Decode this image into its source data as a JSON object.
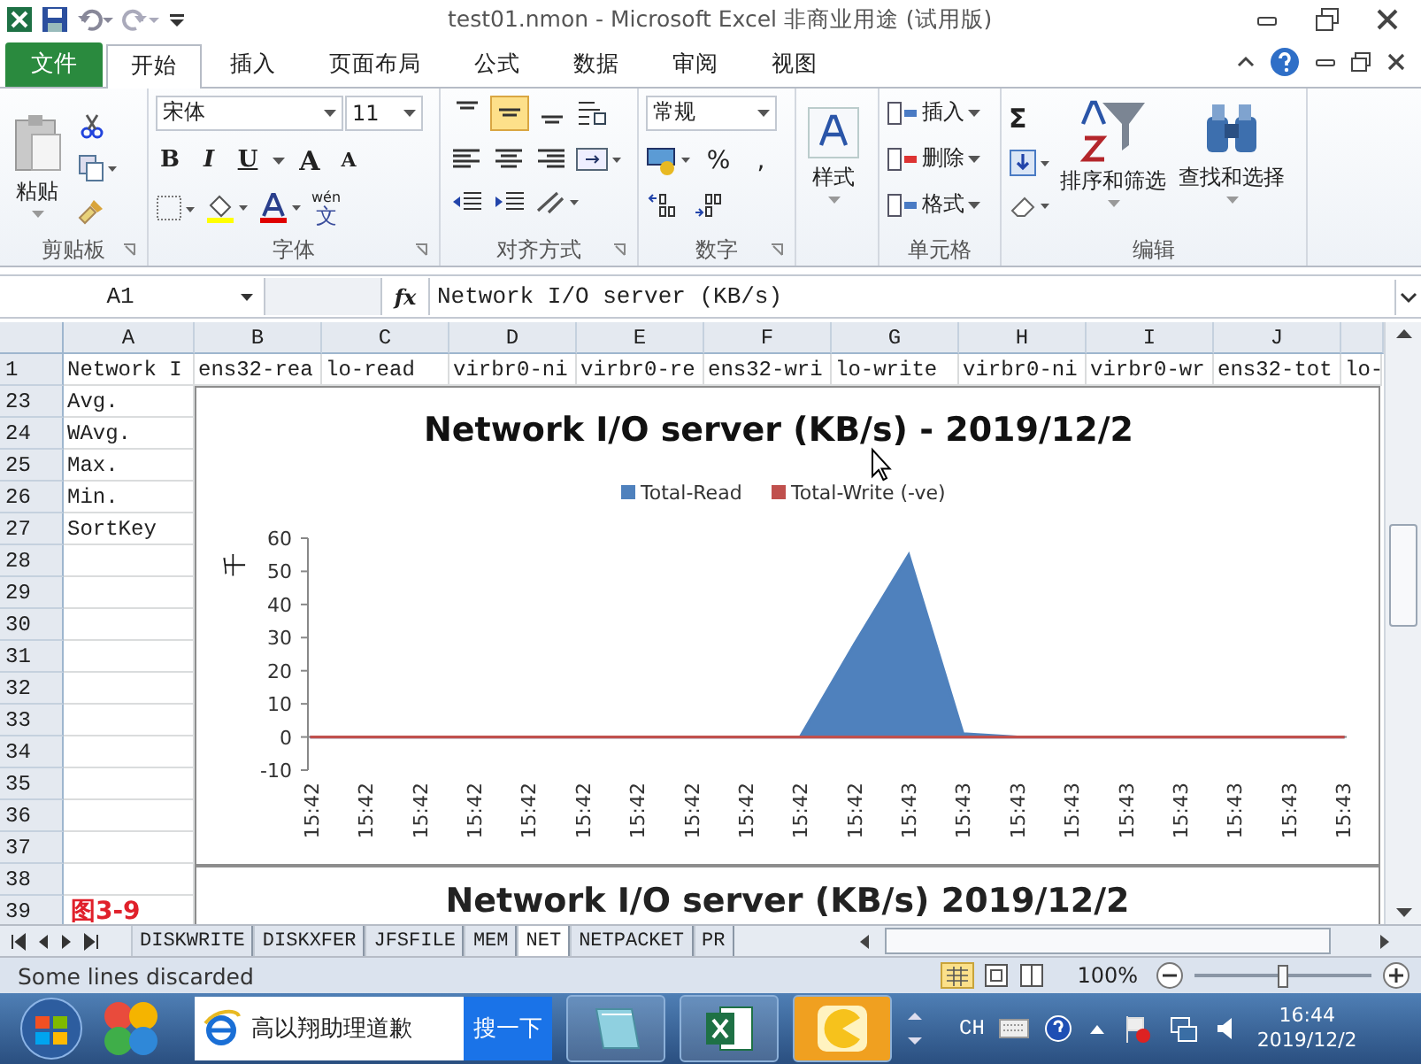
{
  "window": {
    "title": "test01.nmon  -  Microsoft Excel 非商业用途 (试用版)"
  },
  "ribbon_tabs": [
    {
      "label": "文件",
      "kind": "file",
      "selected": false
    },
    {
      "label": "开始",
      "kind": "tab",
      "selected": true
    },
    {
      "label": "插入",
      "kind": "tab",
      "selected": false
    },
    {
      "label": "页面布局",
      "kind": "tab",
      "selected": false
    },
    {
      "label": "公式",
      "kind": "tab",
      "selected": false
    },
    {
      "label": "数据",
      "kind": "tab",
      "selected": false
    },
    {
      "label": "审阅",
      "kind": "tab",
      "selected": false
    },
    {
      "label": "视图",
      "kind": "tab",
      "selected": false
    }
  ],
  "clipboard": {
    "paste": "粘贴",
    "label": "剪贴板"
  },
  "font": {
    "name": "宋体",
    "size": "11",
    "styles": [
      "B",
      "I",
      "U"
    ],
    "grow": "A",
    "shrink": "A",
    "phonetic": [
      "wén",
      "文"
    ],
    "label": "字体"
  },
  "alignment": {
    "label": "对齐方式",
    "vertical": [
      {
        "selected": false
      },
      {
        "selected": true
      },
      {
        "selected": false
      }
    ]
  },
  "number": {
    "format": "常规",
    "percent": "%",
    "comma": ",",
    "label": "数字"
  },
  "styles": {
    "button": "样式"
  },
  "cells": {
    "buttons": [
      "插入",
      "删除",
      "格式"
    ],
    "label": "单元格"
  },
  "editing": {
    "sum": "Σ",
    "sort": "排序和筛选",
    "find": "查找和选择",
    "label": "编辑"
  },
  "formula_bar": {
    "name_box": "A1",
    "fx": "fx",
    "formula": "Network I/O server (KB/s)"
  },
  "sheet": {
    "columns": [
      "A",
      "B",
      "C",
      "D",
      "E",
      "F",
      "G",
      "H",
      "I",
      "J"
    ],
    "rows": [
      {
        "num": "1",
        "cells": [
          "Network I",
          "ens32-rea",
          "lo-read",
          "virbr0-ni",
          "virbr0-re",
          "ens32-wri",
          "lo-write",
          "virbr0-ni",
          "virbr0-wr",
          "ens32-tot",
          "lo-"
        ]
      },
      {
        "num": "23",
        "cells": [
          "Avg."
        ]
      },
      {
        "num": "24",
        "cells": [
          "WAvg."
        ]
      },
      {
        "num": "25",
        "cells": [
          "Max."
        ]
      },
      {
        "num": "26",
        "cells": [
          "Min."
        ]
      },
      {
        "num": "27",
        "cells": [
          "SortKey"
        ]
      },
      {
        "num": "28"
      },
      {
        "num": "29"
      },
      {
        "num": "30"
      },
      {
        "num": "31"
      },
      {
        "num": "32"
      },
      {
        "num": "33"
      },
      {
        "num": "34"
      },
      {
        "num": "35"
      },
      {
        "num": "36"
      },
      {
        "num": "37"
      },
      {
        "num": "38"
      },
      {
        "num": "39"
      }
    ],
    "figure_label": "图3-9"
  },
  "charts": [
    {
      "chart_data": {
        "type": "area",
        "title": "Network I/O server (KB/s) - 2019/12/2",
        "ylabel": "千",
        "categories": [
          "15:42",
          "15:42",
          "15:42",
          "15:42",
          "15:42",
          "15:42",
          "15:42",
          "15:42",
          "15:42",
          "15:42",
          "15:42",
          "15:43",
          "15:43",
          "15:43",
          "15:43",
          "15:43",
          "15:43",
          "15:43",
          "15:43",
          "15:43"
        ],
        "series": [
          {
            "name": "Total-Read",
            "color": "#4f81bd",
            "values": [
              0,
              0,
              0,
              0,
              0,
              0,
              0,
              0,
              0,
              0,
              28,
              55,
              1,
              0,
              0,
              0,
              0,
              0,
              0,
              0
            ]
          },
          {
            "name": "Total-Write (-ve)",
            "color": "#c0504d",
            "values": [
              0,
              0,
              0,
              0,
              0,
              0,
              0,
              0,
              0,
              0,
              0,
              0,
              0,
              0,
              0,
              0,
              0,
              0,
              0,
              0
            ]
          }
        ],
        "legend": "top",
        "ylim": [
          -10,
          60
        ],
        "yticks": [
          -10,
          0,
          10,
          20,
          30,
          40,
          50,
          60
        ]
      }
    },
    {
      "title": "Network I/O server (KB/s)  2019/12/2"
    }
  ],
  "sheet_tabs": [
    {
      "label": "DISKWRITE",
      "selected": false
    },
    {
      "label": "DISKXFER",
      "selected": false
    },
    {
      "label": "JFSFILE",
      "selected": false
    },
    {
      "label": "MEM",
      "selected": false
    },
    {
      "label": "NET",
      "selected": true
    },
    {
      "label": "NETPACKET",
      "selected": false
    },
    {
      "label": "PR",
      "selected": false
    }
  ],
  "status_bar": {
    "message": "Some lines discarded",
    "zoom": "100%",
    "zoom_slider": {
      "level": 0.5
    }
  },
  "taskbar": {
    "search_value": "高以翔助理道歉",
    "search_button": "搜一下",
    "language": "CH",
    "time": "16:44",
    "date": "2019/12/2"
  }
}
